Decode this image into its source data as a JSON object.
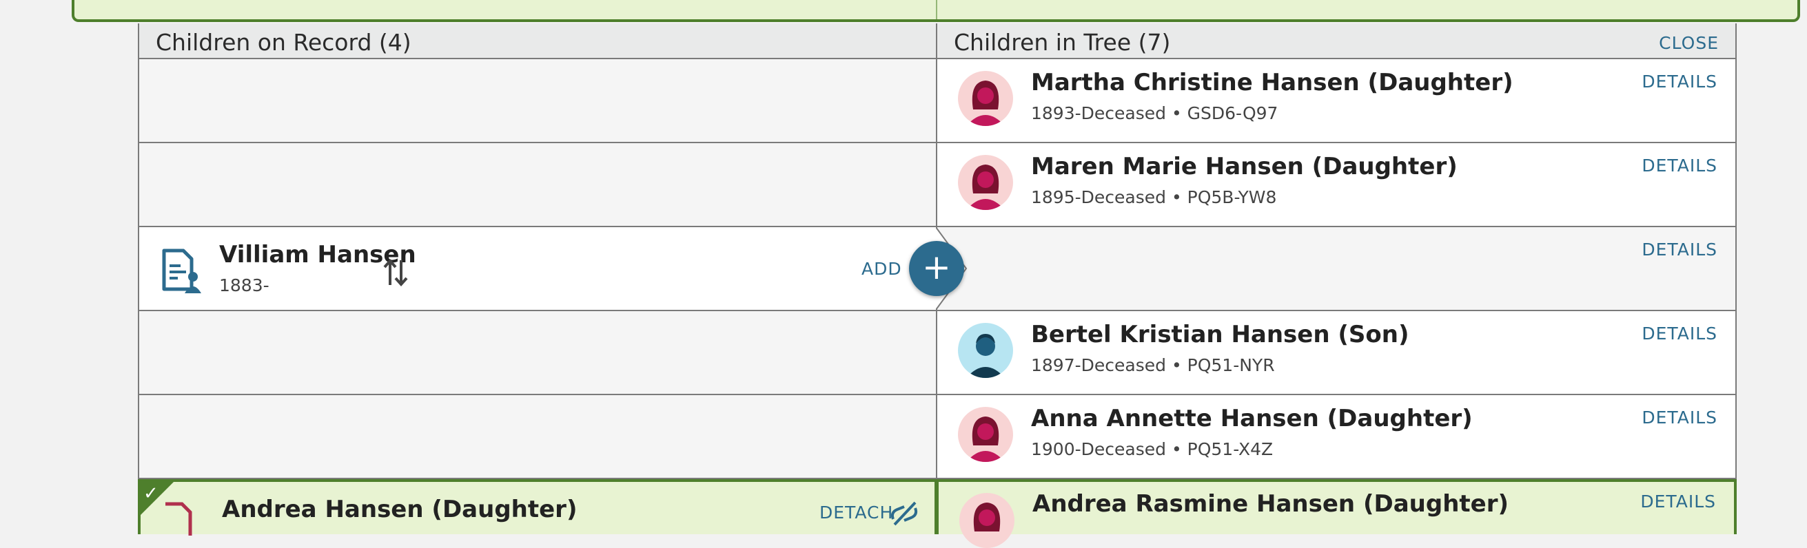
{
  "left_header": "Children on Record (4)",
  "right_header": "Children in Tree (7)",
  "close_label": "CLOSE",
  "details_label": "DETAILS",
  "record_rows": [
    {
      "name": "Villiam Hansen",
      "years": "1883-",
      "action": "ADD",
      "add_symbol": "+"
    },
    {
      "name": "Andrea Hansen (Daughter)",
      "action": "DETACH",
      "attached": true
    }
  ],
  "tree_rows": [
    {
      "name": "Martha Christine Hansen (Daughter)",
      "meta": "1893-Deceased • GSD6-Q97",
      "gender": "female"
    },
    {
      "name": "Maren Marie Hansen (Daughter)",
      "meta": "1895-Deceased • PQ5B-YW8",
      "gender": "female"
    },
    {
      "name": "",
      "meta": "",
      "gender": "none"
    },
    {
      "name": "Bertel Kristian Hansen (Son)",
      "meta": "1897-Deceased • PQ51-NYR",
      "gender": "male"
    },
    {
      "name": "Anna Annette Hansen (Daughter)",
      "meta": "1900-Deceased • PQ51-X4Z",
      "gender": "female"
    },
    {
      "name": "Andrea Rasmine Hansen (Daughter)",
      "meta": "",
      "gender": "female"
    }
  ],
  "colors": {
    "link": "#2c6b8e",
    "attached_border": "#4e7f2c",
    "attached_bg": "#e8f3d2",
    "female_avatar_bg": "#f8d4d4",
    "male_avatar_bg": "#b7e5f2"
  },
  "icons": [
    "record-person-icon",
    "swap-vertical-icon",
    "plus-icon",
    "female-avatar-icon",
    "male-avatar-icon",
    "checkmark-icon",
    "unlink-icon"
  ]
}
